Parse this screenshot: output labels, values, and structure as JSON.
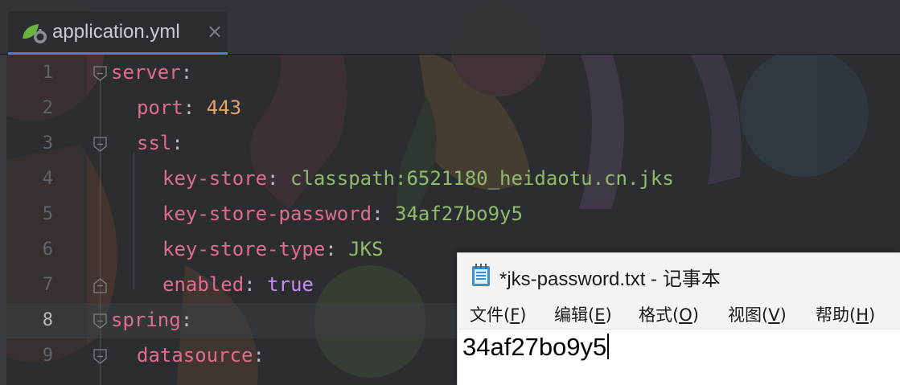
{
  "ide": {
    "tab": {
      "label": "application.yml",
      "close": "×",
      "icon": "spring-leaf-icon"
    },
    "lines": [
      {
        "num": "1",
        "tokens": [
          {
            "t": "server",
            "c": "k"
          },
          {
            "t": ":",
            "c": "p"
          }
        ]
      },
      {
        "num": "2",
        "tokens": [
          {
            "t": "port",
            "c": "k"
          },
          {
            "t": ": ",
            "c": "p"
          },
          {
            "t": "443",
            "c": "n"
          }
        ]
      },
      {
        "num": "3",
        "tokens": [
          {
            "t": "ssl",
            "c": "k"
          },
          {
            "t": ":",
            "c": "p"
          }
        ]
      },
      {
        "num": "4",
        "tokens": [
          {
            "t": "key-store",
            "c": "k"
          },
          {
            "t": ": ",
            "c": "p"
          },
          {
            "t": "classpath:6521180_heidaotu.cn.jks",
            "c": "s"
          }
        ]
      },
      {
        "num": "5",
        "tokens": [
          {
            "t": "key-store-password",
            "c": "k"
          },
          {
            "t": ": ",
            "c": "p"
          },
          {
            "t": "34af27bo9y5",
            "c": "s"
          }
        ]
      },
      {
        "num": "6",
        "tokens": [
          {
            "t": "key-store-type",
            "c": "k"
          },
          {
            "t": ": ",
            "c": "p"
          },
          {
            "t": "JKS",
            "c": "s"
          }
        ]
      },
      {
        "num": "7",
        "tokens": [
          {
            "t": "enabled",
            "c": "k"
          },
          {
            "t": ": ",
            "c": "p"
          },
          {
            "t": "true",
            "c": "b"
          }
        ]
      },
      {
        "num": "8",
        "tokens": [
          {
            "t": "spring",
            "c": "k"
          },
          {
            "t": ":",
            "c": "p"
          }
        ]
      },
      {
        "num": "9",
        "tokens": [
          {
            "t": "datasource",
            "c": "k"
          },
          {
            "t": ":",
            "c": "p"
          }
        ]
      }
    ],
    "current_line": "8",
    "colors": {
      "key": "#e06c8f",
      "number": "#e5a46a",
      "string": "#8ebc6a",
      "bool": "#c98cf0",
      "accent": "#4a7ddc"
    }
  },
  "notepad": {
    "title": "*jks-password.txt - 记事本",
    "icon": "notepad-icon",
    "menu": [
      {
        "label": "文件(",
        "key": "F",
        "end": ")"
      },
      {
        "label": "编辑(",
        "key": "E",
        "end": ")"
      },
      {
        "label": "格式(",
        "key": "O",
        "end": ")"
      },
      {
        "label": "视图(",
        "key": "V",
        "end": ")"
      },
      {
        "label": "帮助(",
        "key": "H",
        "end": ")"
      }
    ],
    "content": "34af27bo9y5"
  }
}
